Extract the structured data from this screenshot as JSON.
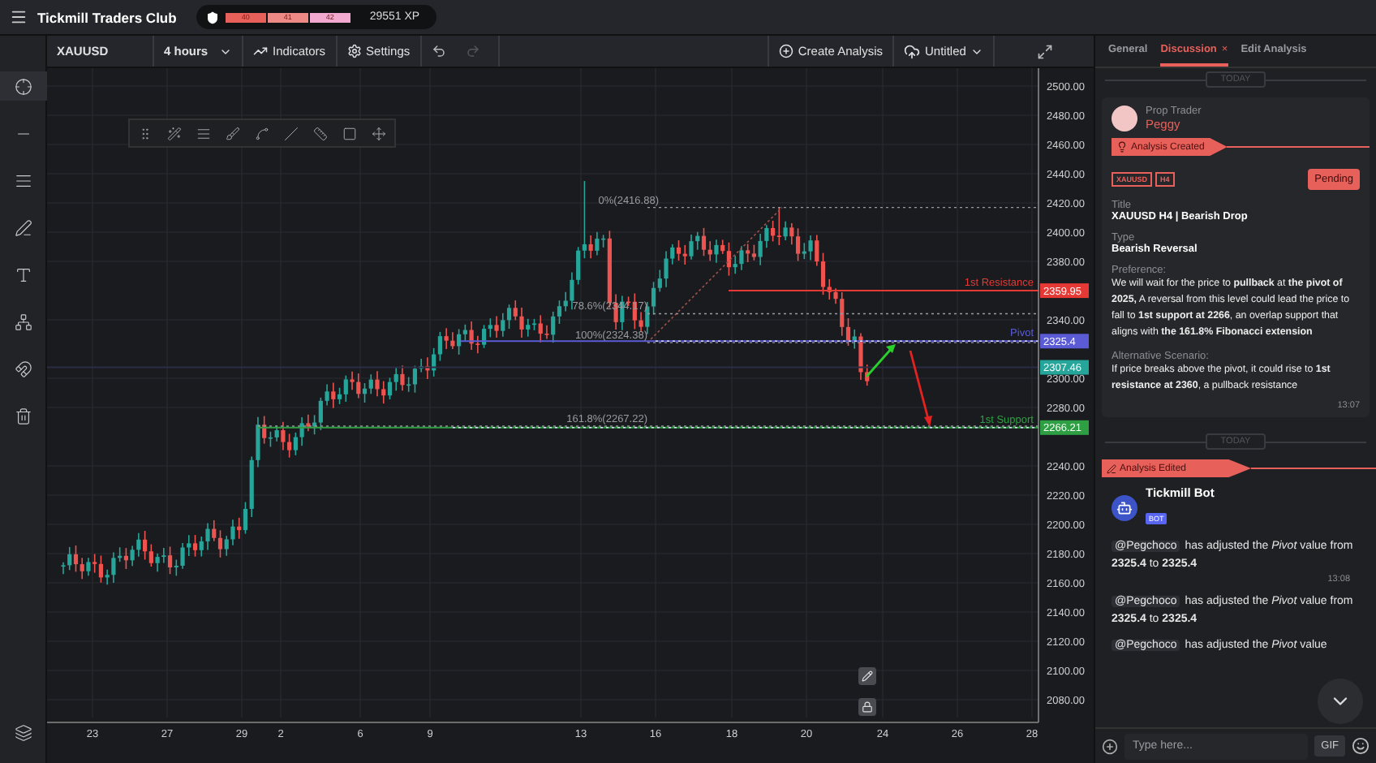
{
  "app_bar": {
    "title": "Tickmill Traders Club",
    "levels": [
      {
        "label": "40",
        "color": "#e8605a"
      },
      {
        "label": "41",
        "color": "#ee8a86"
      },
      {
        "label": "42",
        "color": "#f2a9cf"
      }
    ],
    "xp": "29551 XP"
  },
  "toolbar": {
    "symbol": "XAUUSD",
    "interval": "4 hours",
    "indicators": "Indicators",
    "settings": "Settings",
    "redo_disabled": true,
    "create": "Create Analysis",
    "layout_name": "Untitled"
  },
  "chart": {
    "price_labels": [
      "2500.00",
      "2480.00",
      "2460.00",
      "2440.00",
      "2420.00",
      "2400.00",
      "2380.00",
      "2340.00",
      "2300.00",
      "2280.00",
      "2240.00",
      "2220.00",
      "2200.00",
      "2180.00",
      "2160.00",
      "2140.00",
      "2120.00",
      "2100.00",
      "2080.00"
    ],
    "date_labels": [
      "23",
      "27",
      "29",
      "2",
      "6",
      "9",
      "13",
      "16",
      "18",
      "20",
      "24",
      "26",
      "28"
    ],
    "fib_labels": [
      "0%(2416.88)",
      "78.6%(2344.17)",
      "100%(2324.38)",
      "161.8%(2267.22)"
    ],
    "levels": [
      {
        "kind": "resistance",
        "label": "1st Resistance",
        "value": "2359.95",
        "color": "#e53935"
      },
      {
        "kind": "pivot",
        "label": "Pivot",
        "value": "2325.4",
        "color": "#5b5bd6"
      },
      {
        "kind": "last",
        "value": "2307.46",
        "color": "#26a69a"
      },
      {
        "kind": "support",
        "label": "1st Support",
        "value": "2266.21",
        "color": "#2ea043"
      }
    ]
  },
  "panel": {
    "tabs": [
      {
        "label": "General",
        "selected": false
      },
      {
        "label": "Discussion",
        "selected": true,
        "close_glyph": "×"
      },
      {
        "label": "Edit Analysis",
        "selected": false
      }
    ],
    "feed": [
      {
        "kind": "divider",
        "label": "TODAY"
      },
      {
        "kind": "analysis",
        "role": "Prop Trader",
        "name": "Peggy",
        "event": "Analysis Created",
        "tags": [
          "XAUUSD",
          "H4"
        ],
        "status": "Pending",
        "sections": [
          {
            "kind": "field",
            "label": "Title",
            "text": "XAUUSD H4 | Bearish Drop"
          },
          {
            "kind": "field",
            "label": "Type",
            "text": "Bearish Reversal"
          },
          {
            "kind": "note",
            "label": "Preference:",
            "text": "We will wait for the price to **pullback** at **the pivot of 2025,** A reversal from this level could lead the price to fall to **1st support at 2266**, an overlap support that aligns with **the 161.8% Fibonacci extension**"
          },
          {
            "kind": "note",
            "label": "Alternative Scenario:",
            "text": "If price breaks above the pivot, it could rise to **1st resistance at 2360**, a pullback resistance"
          }
        ],
        "time": "13:07"
      },
      {
        "kind": "divider",
        "label": "TODAY"
      },
      {
        "kind": "bot",
        "event": "Analysis Edited",
        "name": "Tickmill Bot",
        "badge": "BOT",
        "messages": [
          {
            "user": "@Pegchoco",
            "text": "has adjusted the *Pivot* value from **2325.4** to **2325.4**",
            "time": "13:08"
          },
          {
            "user": "@Pegchoco",
            "text": "has adjusted the *Pivot* value from **2325.4** to **2325.4**"
          },
          {
            "user": "@Pegchoco",
            "text": "has adjusted the *Pivot* value"
          }
        ]
      }
    ],
    "composer": {
      "placeholder": "Type here...",
      "gif": "GIF"
    }
  }
}
